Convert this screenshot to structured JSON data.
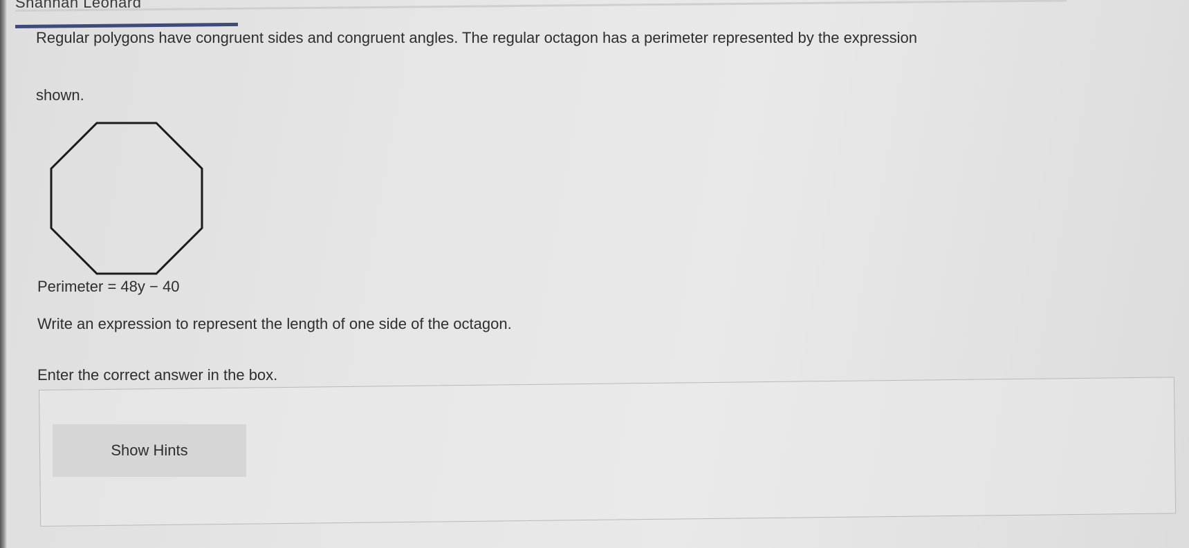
{
  "header": {
    "student_name": "Shannah Leonard"
  },
  "progress": {
    "value": 0.21
  },
  "question": {
    "intro_line_1": "Regular polygons have congruent sides and congruent angles. The regular octagon has a perimeter represented by the expression",
    "intro_line_2": "shown.",
    "perimeter_label": "Perimeter = 48y − 40",
    "prompt": "Write an expression to represent the length of one side of the octagon.",
    "instruction": "Enter the correct answer in the box."
  },
  "answer": {
    "value": ""
  },
  "hints": {
    "button_label": "Show Hints"
  },
  "icons": {
    "octagon": "octagon-figure"
  },
  "colors": {
    "progress_fill": "#3d4a7a",
    "text": "#2e2e2e"
  }
}
